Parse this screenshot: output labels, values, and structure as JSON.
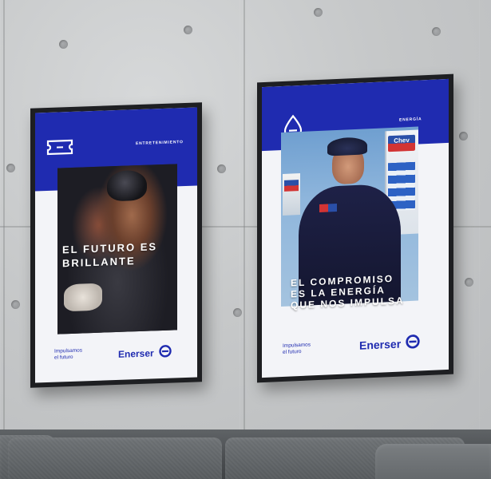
{
  "scene": {
    "description_colors": {
      "brand_blue": "#1f2bb0",
      "poster_bg": "#f3f4f8",
      "frame": "#1e1f22",
      "wall": "#c9cbcc",
      "sofa": "#55595c"
    }
  },
  "poster_left": {
    "top_label": "ENTRETENIMIENTO",
    "headline": "EL FUTURO ES\nBRILLANTE",
    "tagline": "Impulsamos\nel futuro",
    "brand_name": "Enerser",
    "top_icon": "ticket-icon",
    "brand_icon": "enerser-logo-icon"
  },
  "poster_right": {
    "top_label": "ENERGÍA",
    "headline": "EL COMPROMISO\nES LA ENERGÍA\nQUE NOS IMPULSA",
    "tagline": "Impulsamos\nel futuro",
    "brand_name": "Enerser",
    "photo_sign_text": "Chev",
    "top_icon": "drop-icon",
    "brand_icon": "enerser-logo-icon"
  }
}
